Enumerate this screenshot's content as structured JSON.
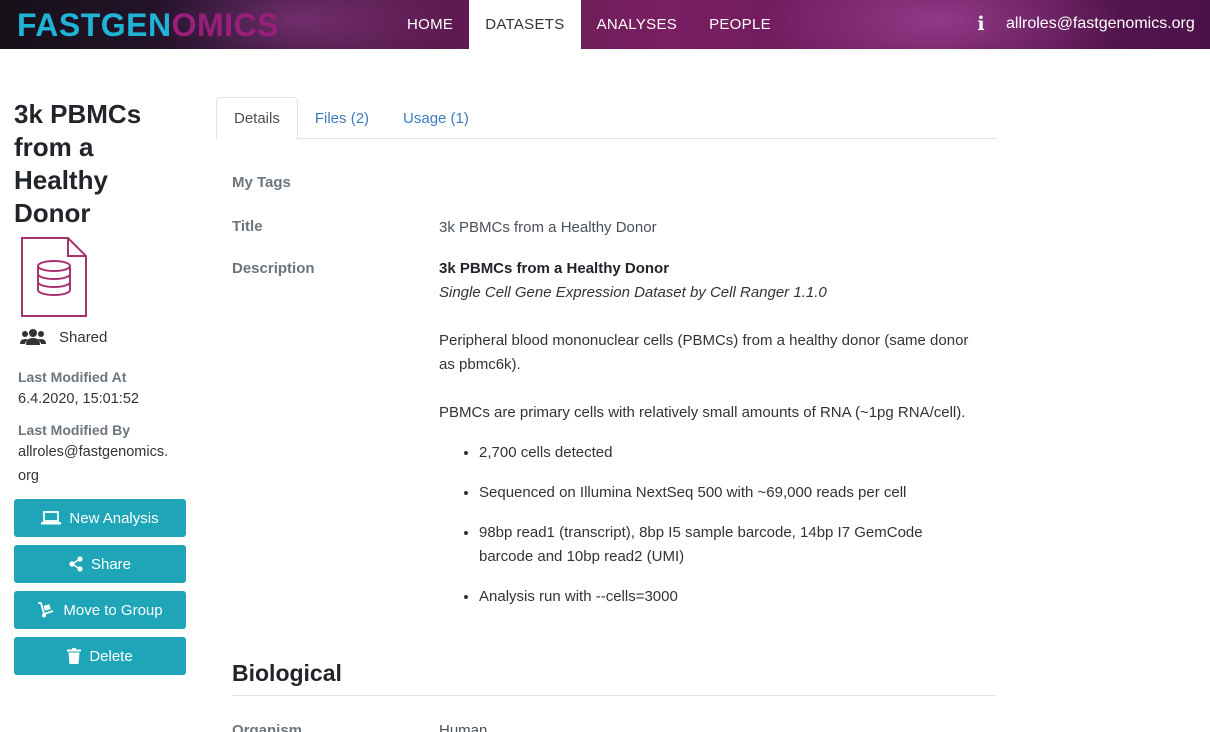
{
  "navbar": {
    "logo_part1": "FASTGEN",
    "logo_part2": "OMICS",
    "links": [
      "HOME",
      "DATASETS",
      "ANALYSES",
      "PEOPLE"
    ],
    "active_link": "DATASETS",
    "info_icon": "info-icon",
    "user_email": "allroles@fastgenomics.org"
  },
  "sidebar": {
    "title": "3k PBMCs from a Healthy Donor",
    "file_icon": "database-file-icon",
    "shared_label": "Shared",
    "last_modified_at_label": "Last Modified At",
    "last_modified_at_value": "6.4.2020, 15:01:52",
    "last_modified_by_label": "Last Modified By",
    "last_modified_by_value_line1": "allroles@fastgenomics.",
    "last_modified_by_value_line2": "org",
    "buttons": {
      "new_analysis": "New Analysis",
      "share": "Share",
      "move_to_group": "Move to Group",
      "delete": "Delete"
    }
  },
  "tabs": {
    "details": "Details",
    "files": "Files (2)",
    "usage": "Usage (1)"
  },
  "details": {
    "my_tags_label": "My Tags",
    "title_label": "Title",
    "title_value": "3k PBMCs from a Healthy Donor",
    "description_label": "Description",
    "description": {
      "heading": "3k PBMCs from a Healthy Donor",
      "subheading": "Single Cell Gene Expression Dataset by Cell Ranger 1.1.0",
      "para1": "Peripheral blood mononuclear cells (PBMCs) from a healthy donor (same donor as pbmc6k).",
      "para2": "PBMCs are primary cells with relatively small amounts of RNA (~1pg RNA/cell).",
      "bullets": [
        "2,700 cells detected",
        "Sequenced on Illumina NextSeq 500 with ~69,000 reads per cell",
        "98bp read1 (transcript), 8bp I5 sample barcode, 14bp I7 GemCode barcode and 10bp read2 (UMI)",
        "Analysis run with --cells=3000"
      ]
    }
  },
  "biological": {
    "section_title": "Biological",
    "organism_label": "Organism",
    "organism_value": "Human"
  },
  "colors": {
    "accent_button": "#1ea6b8",
    "logo_cyan": "#1fb4d6",
    "logo_magenta": "#9a1f7c",
    "link": "#3b7bbf"
  }
}
